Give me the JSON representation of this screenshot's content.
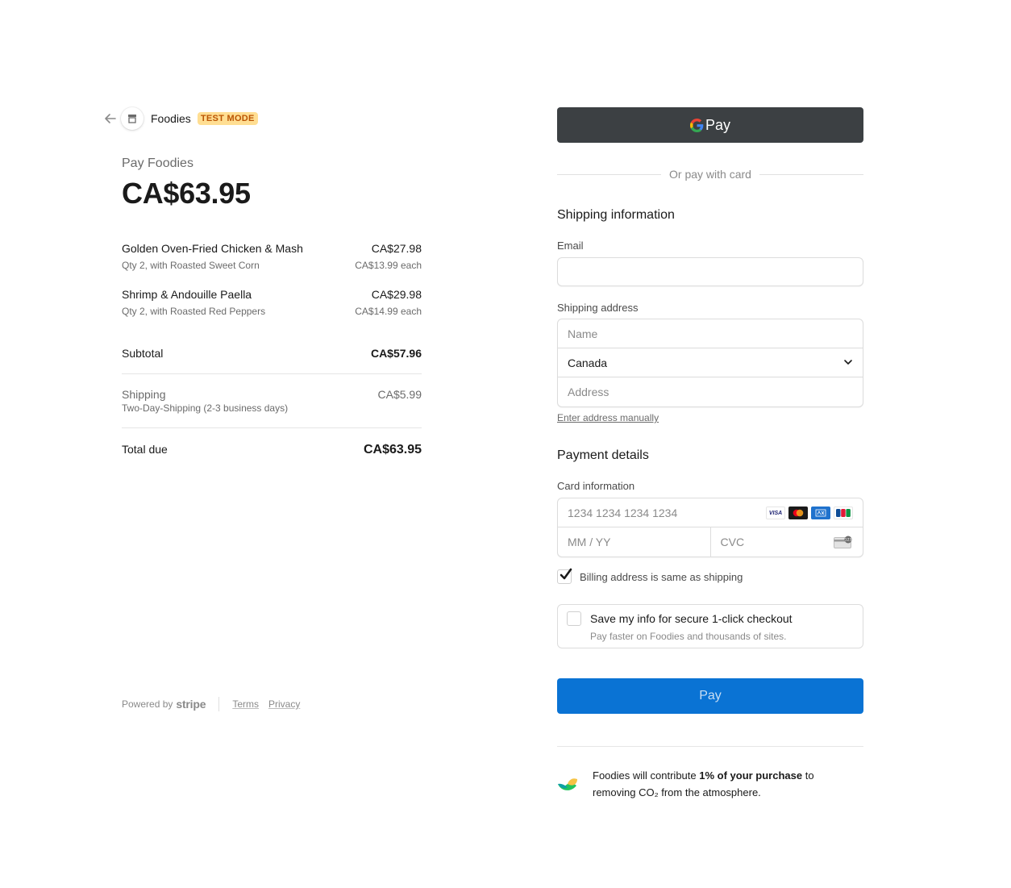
{
  "header": {
    "merchant_name": "Foodies",
    "badge": "TEST MODE",
    "back_icon": "arrow-left-icon",
    "logo_icon": "store-icon"
  },
  "summary": {
    "pay_label": "Pay Foodies",
    "amount": "CA$63.95",
    "line_items": [
      {
        "name": "Golden Oven-Fried Chicken & Mash",
        "total": "CA$27.98",
        "detail": "Qty 2, with Roasted Sweet Corn",
        "unit": "CA$13.99 each"
      },
      {
        "name": "Shrimp & Andouille Paella",
        "total": "CA$29.98",
        "detail": "Qty 2, with Roasted Red Peppers",
        "unit": "CA$14.99 each"
      }
    ],
    "subtotal_label": "Subtotal",
    "subtotal_value": "CA$57.96",
    "shipping_label": "Shipping",
    "shipping_value": "CA$5.99",
    "shipping_detail": "Two-Day-Shipping (2-3 business days)",
    "total_label": "Total due",
    "total_value": "CA$63.95"
  },
  "footer": {
    "powered_by": "Powered by",
    "brand": "stripe",
    "terms": "Terms",
    "privacy": "Privacy"
  },
  "payment": {
    "gpay_label": "Pay",
    "or_text": "Or pay with card",
    "shipping_title": "Shipping information",
    "email_label": "Email",
    "email_value": "",
    "shipping_address_label": "Shipping address",
    "name_placeholder": "Name",
    "country_value": "Canada",
    "address_placeholder": "Address",
    "enter_manually": "Enter address manually",
    "payment_title": "Payment details",
    "card_label": "Card information",
    "card_placeholder": "1234 1234 1234 1234",
    "expiry_placeholder": "MM / YY",
    "cvc_placeholder": "CVC",
    "card_brands": [
      "VISA",
      "mastercard",
      "amex",
      "JCB"
    ],
    "billing_same_label": "Billing address is same as shipping",
    "billing_same_checked": true,
    "save_title": "Save my info for secure 1-click checkout",
    "save_subtitle": "Pay faster on Foodies and thousands of sites.",
    "save_checked": false,
    "pay_button": "Pay"
  },
  "climate": {
    "prefix": "Foodies will contribute ",
    "bold": "1% of your purchase",
    "suffix": " to removing CO₂ from the atmosphere."
  },
  "colors": {
    "pay_button": "#0a73d4",
    "gpay_button": "#3c4043",
    "badge_bg": "#ffde92",
    "badge_text": "#bb5504"
  }
}
